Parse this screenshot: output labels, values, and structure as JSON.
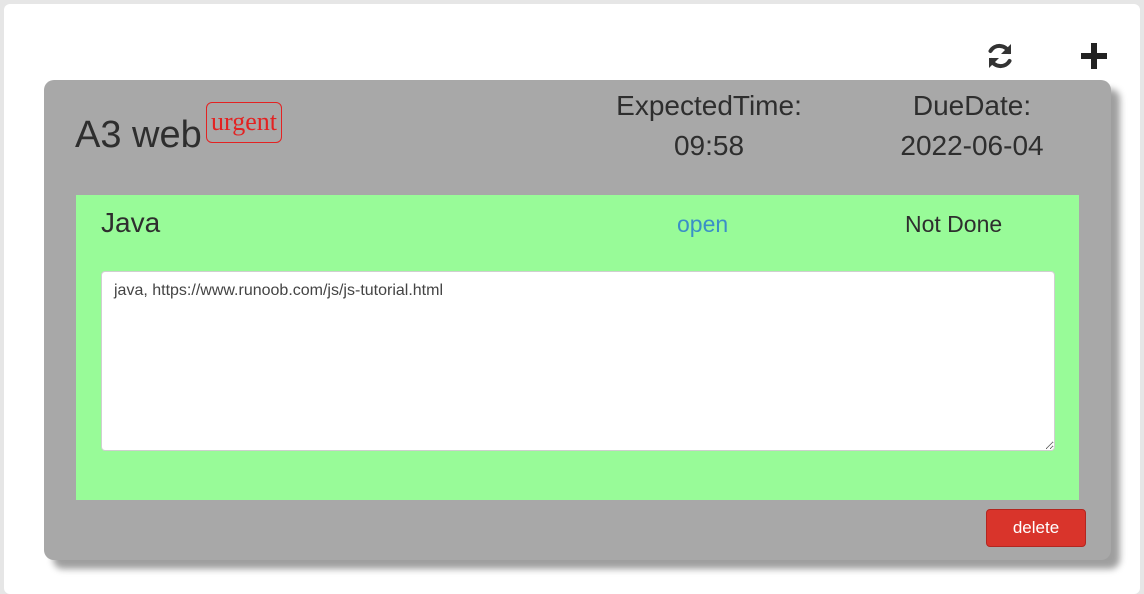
{
  "toolbar": {
    "refresh_icon": "refresh-icon",
    "add_icon": "plus-icon"
  },
  "task": {
    "title": "A3 web",
    "tag": "urgent",
    "expected_time_label": "ExpectedTime:",
    "expected_time": "09:58",
    "due_date_label": "DueDate:",
    "due_date": "2022-06-04",
    "subtask": {
      "name": "Java",
      "link_label": "open",
      "status": "Not Done",
      "notes": "java, https://www.runoob.com/js/js-tutorial.html"
    },
    "delete_label": "delete"
  },
  "colors": {
    "card": "#a8a8a8",
    "subtask": "#98fb98",
    "tag": "#e32222",
    "link": "#3a8fc7",
    "delete": "#d9342b"
  }
}
